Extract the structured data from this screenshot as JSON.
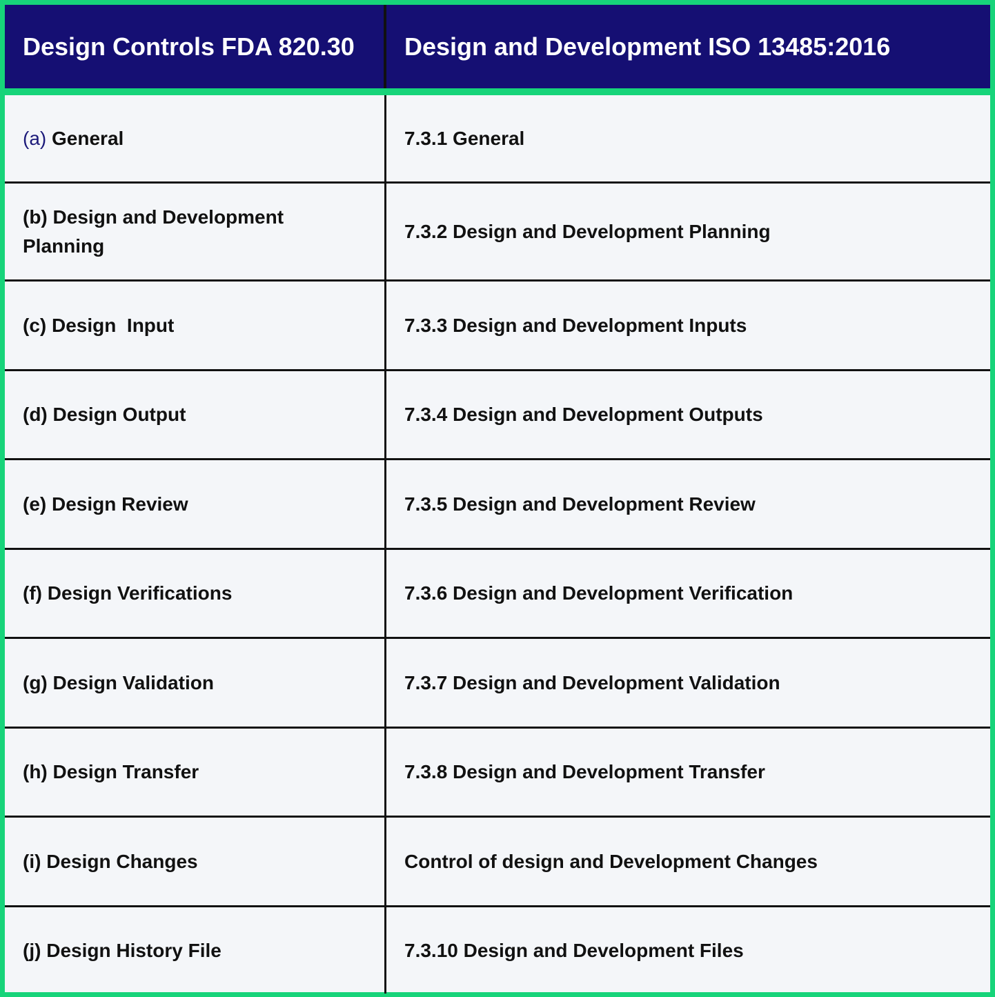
{
  "colors": {
    "header_bg": "#150f73",
    "frame_border": "#17d47a",
    "row_bg": "#f4f6f9",
    "grid_line": "#111111",
    "accent_text": "#1c1a7a"
  },
  "table": {
    "headers": [
      "Design Controls FDA 820.30",
      "Design and Development ISO 13485:2016"
    ],
    "rows": [
      {
        "fda_prefix": "(a)",
        "fda": " General",
        "iso": "7.3.1 General"
      },
      {
        "fda_prefix": "(b)",
        "fda": " Design and Development Planning",
        "iso": "7.3.2 Design and Development Planning"
      },
      {
        "fda_prefix": "(c)",
        "fda": " Design  Input",
        "iso": "7.3.3 Design and Development Inputs"
      },
      {
        "fda_prefix": "(d)",
        "fda": " Design Output",
        "iso": "7.3.4 Design and Development Outputs"
      },
      {
        "fda_prefix": "(e)",
        "fda": " Design Review",
        "iso": "7.3.5 Design and Development Review"
      },
      {
        "fda_prefix": "(f)",
        "fda": " Design Verifications",
        "iso": "7.3.6 Design and Development Verification"
      },
      {
        "fda_prefix": "(g)",
        "fda": " Design Validation",
        "iso": "7.3.7 Design and Development Validation"
      },
      {
        "fda_prefix": "(h)",
        "fda": " Design Transfer",
        "iso": "7.3.8 Design and Development Transfer"
      },
      {
        "fda_prefix": "(i)",
        "fda": " Design Changes",
        "iso": "Control of design and Development Changes"
      },
      {
        "fda_prefix": "(j)",
        "fda": " Design History File",
        "iso": "7.3.10 Design and Development Files"
      }
    ]
  }
}
